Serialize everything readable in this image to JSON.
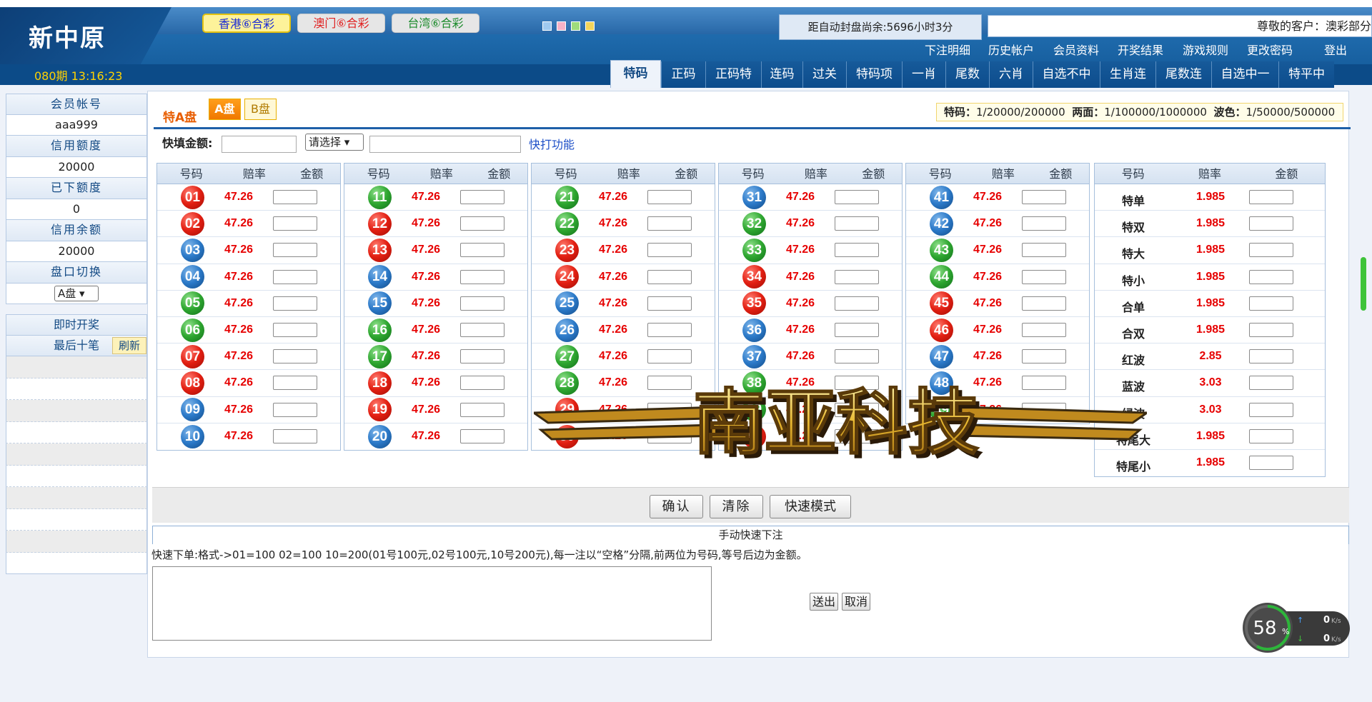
{
  "header": {
    "logo": "新中原",
    "period": "080期 13:16:23",
    "lotteries": [
      "香港⑥合彩",
      "澳门⑥合彩",
      "台湾⑥合彩"
    ],
    "countdown": "距自动封盘尚余:5696小时3分",
    "greeting": "尊敬的客户：澳彩部分",
    "links": [
      "下注明细",
      "历史帐户",
      "会员资料",
      "开奖结果",
      "游戏规则",
      "更改密码",
      "登出"
    ],
    "nav": [
      "特码",
      "正码",
      "正码特",
      "连码",
      "过关",
      "特码项",
      "一肖",
      "尾数",
      "六肖",
      "自选不中",
      "生肖连",
      "尾数连",
      "自选中一",
      "特平中"
    ]
  },
  "sidebar": {
    "account_label": "会员帐号",
    "account": "aaa999",
    "credit_label": "信用额度",
    "credit": "20000",
    "bet_label": "已下额度",
    "bet": "0",
    "balance_label": "信用余额",
    "balance": "20000",
    "pan_label": "盘口切换",
    "pan_value": "A盘",
    "live_draw": "即时开奖",
    "last_ten": "最后十笔",
    "refresh": "刷新"
  },
  "panel": {
    "title": "特A盘",
    "a_btn": "A盘",
    "b_btn": "B盘",
    "odds_info": [
      {
        "label": "特码：",
        "value": "1/20000/200000"
      },
      {
        "label": "两面：",
        "value": "1/100000/1000000"
      },
      {
        "label": "波色：",
        "value": "1/50000/500000"
      }
    ],
    "quick_label": "快填金额:",
    "quick_select": "请选择",
    "quick_link": "快打功能",
    "col_headers": [
      "号码",
      "赔率",
      "金额"
    ],
    "rate": "47.26",
    "numbers": [
      {
        "n": "01",
        "c": "red"
      },
      {
        "n": "02",
        "c": "red"
      },
      {
        "n": "03",
        "c": "blue"
      },
      {
        "n": "04",
        "c": "blue"
      },
      {
        "n": "05",
        "c": "green"
      },
      {
        "n": "06",
        "c": "green"
      },
      {
        "n": "07",
        "c": "red"
      },
      {
        "n": "08",
        "c": "red"
      },
      {
        "n": "09",
        "c": "blue"
      },
      {
        "n": "10",
        "c": "blue"
      },
      {
        "n": "11",
        "c": "green"
      },
      {
        "n": "12",
        "c": "red"
      },
      {
        "n": "13",
        "c": "red"
      },
      {
        "n": "14",
        "c": "blue"
      },
      {
        "n": "15",
        "c": "blue"
      },
      {
        "n": "16",
        "c": "green"
      },
      {
        "n": "17",
        "c": "green"
      },
      {
        "n": "18",
        "c": "red"
      },
      {
        "n": "19",
        "c": "red"
      },
      {
        "n": "20",
        "c": "blue"
      },
      {
        "n": "21",
        "c": "green"
      },
      {
        "n": "22",
        "c": "green"
      },
      {
        "n": "23",
        "c": "red"
      },
      {
        "n": "24",
        "c": "red"
      },
      {
        "n": "25",
        "c": "blue"
      },
      {
        "n": "26",
        "c": "blue"
      },
      {
        "n": "27",
        "c": "green"
      },
      {
        "n": "28",
        "c": "green"
      },
      {
        "n": "29",
        "c": "red"
      },
      {
        "n": "30",
        "c": "red"
      },
      {
        "n": "31",
        "c": "blue"
      },
      {
        "n": "32",
        "c": "green"
      },
      {
        "n": "33",
        "c": "green"
      },
      {
        "n": "34",
        "c": "red"
      },
      {
        "n": "35",
        "c": "red"
      },
      {
        "n": "36",
        "c": "blue"
      },
      {
        "n": "37",
        "c": "blue"
      },
      {
        "n": "38",
        "c": "green"
      },
      {
        "n": "39",
        "c": "green"
      },
      {
        "n": "40",
        "c": "red"
      },
      {
        "n": "41",
        "c": "blue"
      },
      {
        "n": "42",
        "c": "blue"
      },
      {
        "n": "43",
        "c": "green"
      },
      {
        "n": "44",
        "c": "green"
      },
      {
        "n": "45",
        "c": "red"
      },
      {
        "n": "46",
        "c": "red"
      },
      {
        "n": "47",
        "c": "blue"
      },
      {
        "n": "48",
        "c": "blue"
      },
      {
        "n": "49",
        "c": "green"
      }
    ],
    "extras": [
      {
        "name": "特单",
        "rate": "1.985"
      },
      {
        "name": "特双",
        "rate": "1.985"
      },
      {
        "name": "特大",
        "rate": "1.985"
      },
      {
        "name": "特小",
        "rate": "1.985"
      },
      {
        "name": "合单",
        "rate": "1.985"
      },
      {
        "name": "合双",
        "rate": "1.985"
      },
      {
        "name": "红波",
        "rate": "2.85"
      },
      {
        "name": "蓝波",
        "rate": "3.03"
      },
      {
        "name": "绿波",
        "rate": "3.03"
      },
      {
        "name": "特尾大",
        "rate": "1.985"
      },
      {
        "name": "特尾小",
        "rate": "1.985"
      }
    ],
    "confirm": "确认",
    "clear": "清除",
    "fast_mode": "快速模式",
    "manual_title": "手动快速下注",
    "hint": "快速下单:格式->01=100 02=100 10=200(01号100元,02号100元,10号200元),每一注以“空格”分隔,前两位为号码,等号后边为金额。",
    "send": "送出",
    "cancel": "取消"
  },
  "overlay": {
    "watermark": "南亚科技",
    "speed_percent": "58",
    "up_speed": "0",
    "down_speed": "0",
    "speed_unit": "K/s"
  },
  "colors": {
    "red": "#e21f12",
    "blue": "#2b79c8",
    "green": "#2ea630",
    "header": "#1a5d99",
    "rate": "#e60000"
  }
}
